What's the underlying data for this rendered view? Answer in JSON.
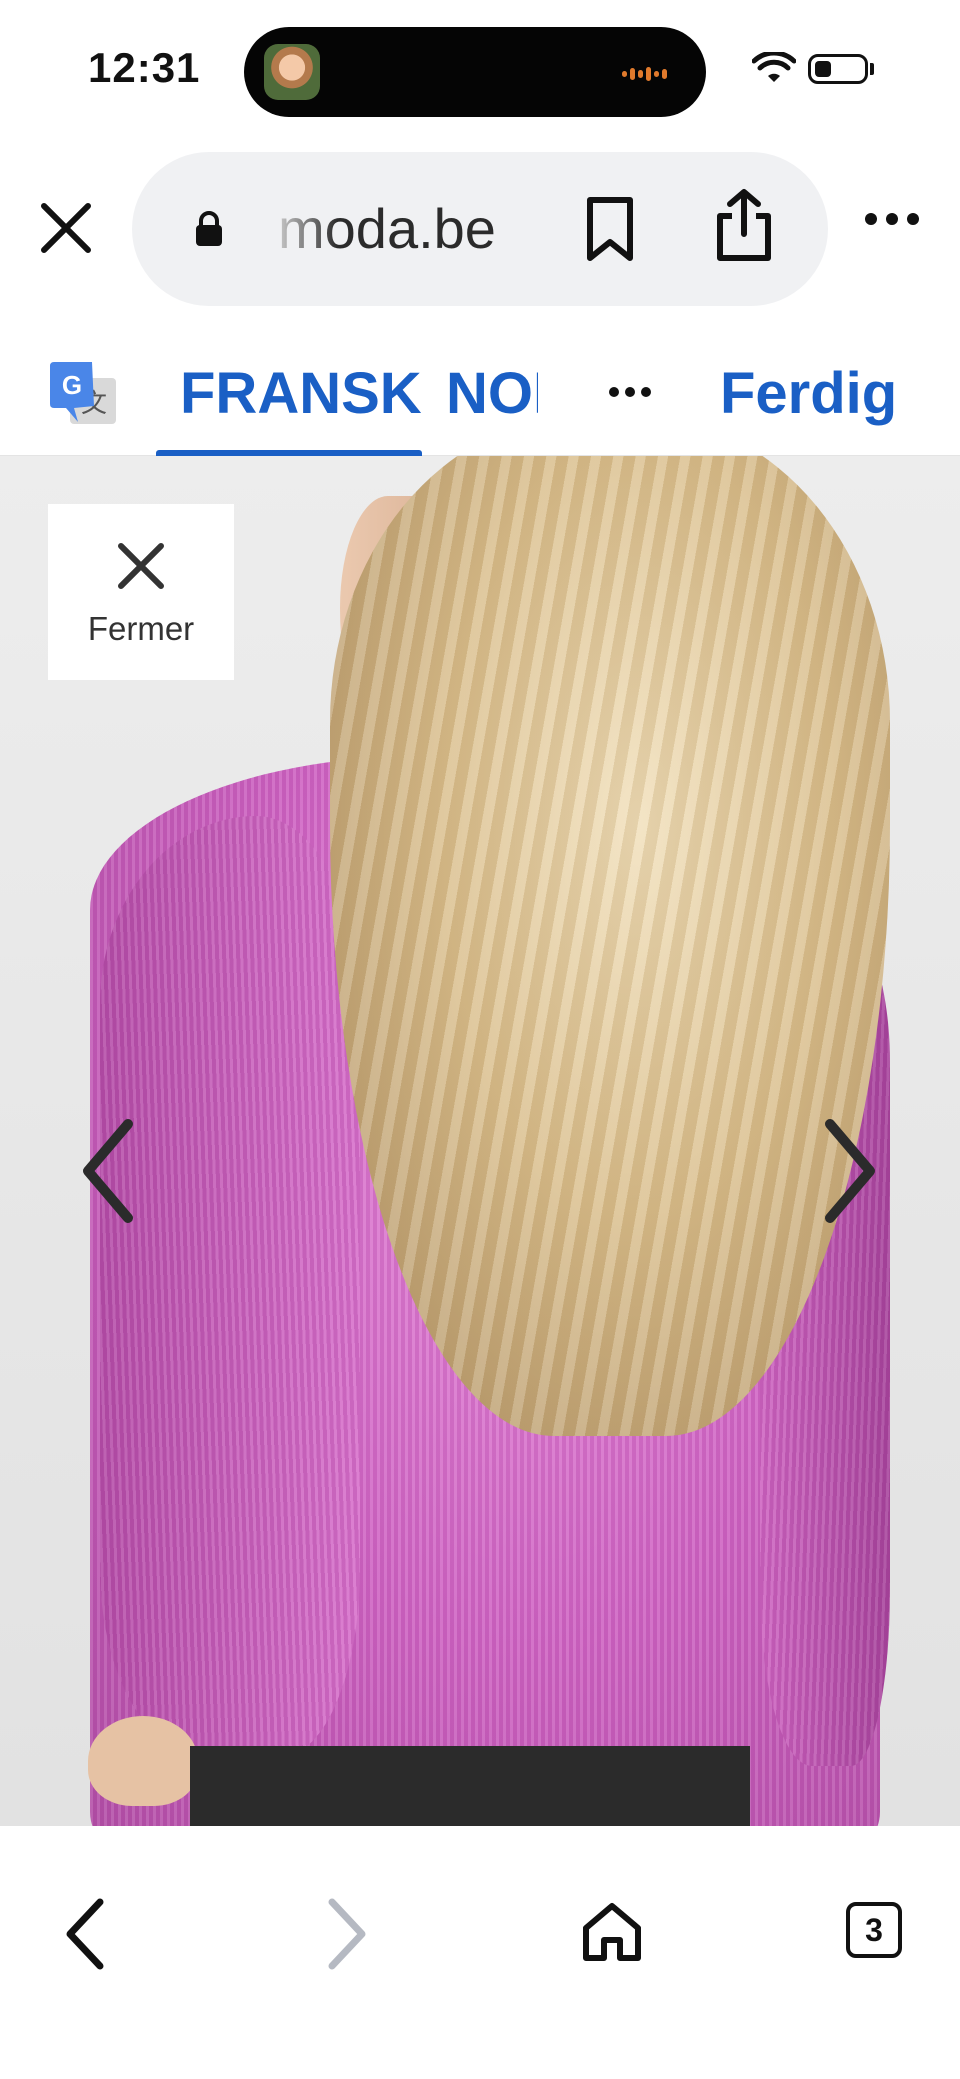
{
  "status_bar": {
    "time": "12:31"
  },
  "browser": {
    "url": "moda.be",
    "close_icon": "close-icon",
    "lock_icon": "lock-icon",
    "bookmark_icon": "bookmark-icon",
    "share_icon": "share-icon",
    "more_icon": "more-icon"
  },
  "translate_bar": {
    "source_language": "FRANSK",
    "target_language": "NORSK",
    "done_label": "Ferdig",
    "more_icon": "more-icon"
  },
  "viewer": {
    "close_label": "Fermer",
    "prev_icon": "chevron-left-icon",
    "next_icon": "chevron-right-icon"
  },
  "bottom_bar": {
    "tab_count": "3",
    "icons": [
      "back-icon",
      "forward-icon",
      "home-icon",
      "tabs-icon"
    ]
  },
  "colors": {
    "link_blue": "#1a5fc5",
    "jacket_pink": "#cf64c3"
  }
}
